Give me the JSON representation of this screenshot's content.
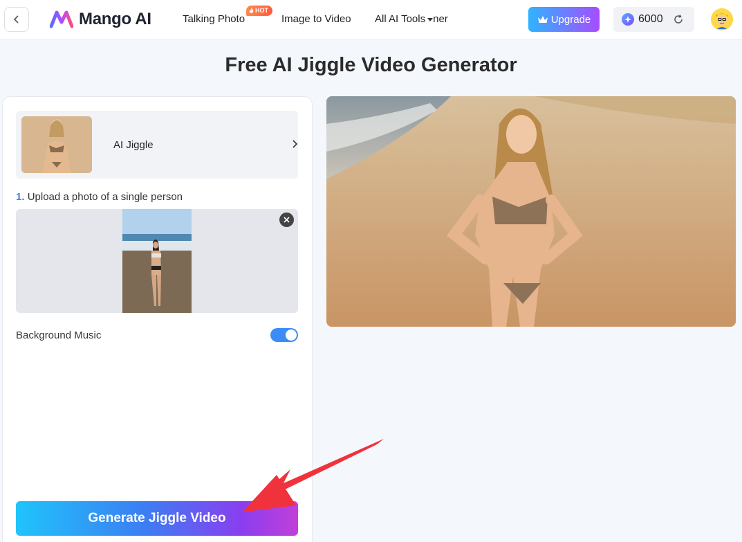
{
  "header": {
    "logo_text": "Mango AI",
    "nav": [
      {
        "label": "Talking Photo",
        "badge": "HOT"
      },
      {
        "label": "Image to Video"
      },
      {
        "label": "All AI Tools",
        "tail": "ner"
      }
    ],
    "upgrade_label": "Upgrade",
    "credits": "6000"
  },
  "page": {
    "title": "Free AI Jiggle Video Generator"
  },
  "effect": {
    "label": "AI Jiggle"
  },
  "upload": {
    "step_number": "1.",
    "step_text": "Upload a photo of a single person"
  },
  "settings": {
    "music_label": "Background Music",
    "music_enabled": true
  },
  "actions": {
    "generate_label": "Generate Jiggle Video"
  },
  "colors": {
    "accent": "#3b7ff3",
    "toggle_on": "#3b8cf6",
    "arrow": "#f0323c"
  }
}
